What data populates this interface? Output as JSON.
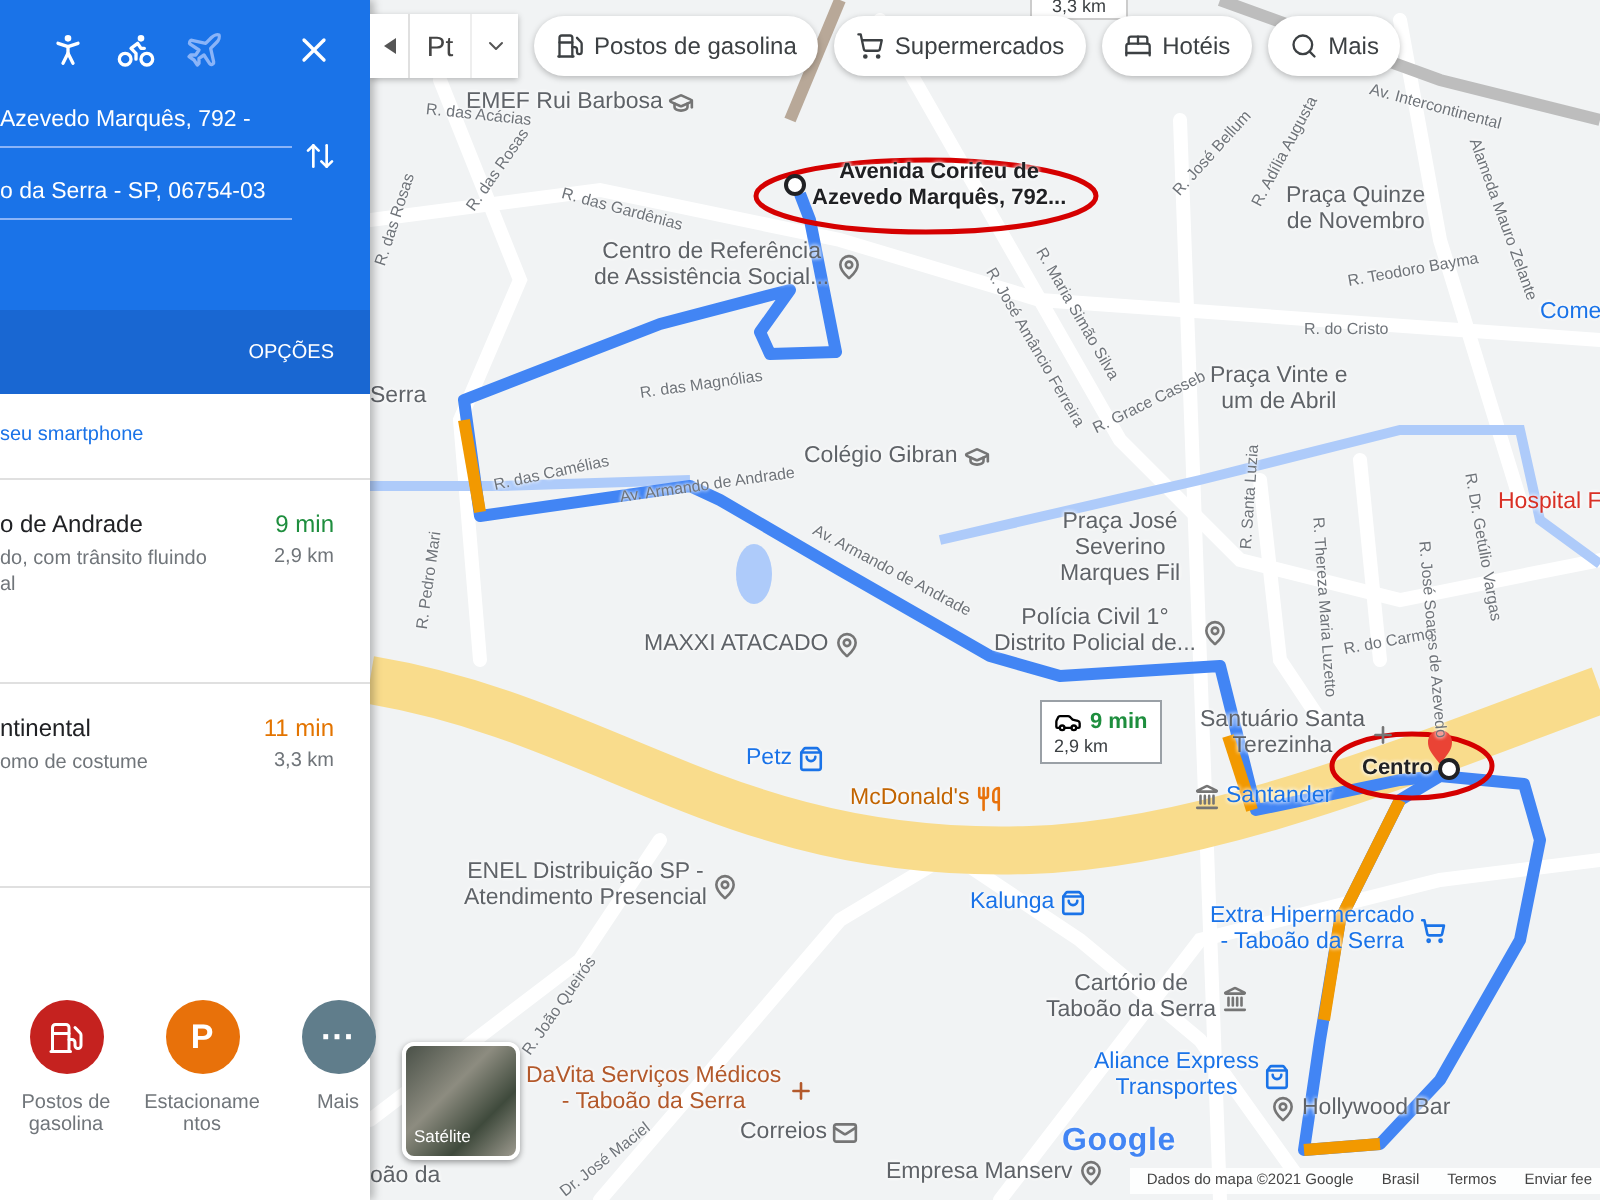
{
  "panel": {
    "modes": [
      {
        "kind": "walk",
        "disabled": false
      },
      {
        "kind": "bike",
        "disabled": false
      },
      {
        "kind": "plane",
        "disabled": true
      }
    ],
    "origin": "Azevedo Marquês, 792 -",
    "destination": "o da Serra - SP, 06754-03",
    "options_label": "OPÇÕES",
    "phone_link": "seu smartphone",
    "routes": [
      {
        "title": "o de Andrade",
        "time": "9 min",
        "color": "#1e8e3e",
        "lines": [
          "do, com trânsito fluindo",
          "al"
        ],
        "distance": "2,9 km"
      },
      {
        "title": "ntinental",
        "time": "11 min",
        "color": "#e37400",
        "lines": [
          "omo de costume"
        ],
        "distance": "3,3 km"
      }
    ],
    "categories": [
      {
        "kind": "gas",
        "label": "Postos de gasolina",
        "color": "#c5221f"
      },
      {
        "kind": "parking",
        "label": "Estacionamentos",
        "glyph": "P",
        "color": "#e8710a"
      },
      {
        "kind": "more",
        "label": "Mais",
        "glyph": "···",
        "color": "#607d8b"
      }
    ]
  },
  "map": {
    "layer_label": "Pt",
    "chips": [
      {
        "kind": "gas",
        "label": "Postos de gasolina"
      },
      {
        "kind": "cart",
        "label": "Supermercados"
      },
      {
        "kind": "bed",
        "label": "Hotéis"
      },
      {
        "kind": "search",
        "label": "Mais"
      }
    ],
    "top_distance": "3,3 km",
    "route_info": {
      "time": "9 min",
      "distance": "2,9 km"
    },
    "labels": [
      {
        "kind": "place",
        "lines": [
          "EMEF Rui Barbosa"
        ]
      },
      {
        "kind": "place",
        "lines": [
          "Centro de Referência",
          "de Assistência Social..."
        ]
      },
      {
        "kind": "marker",
        "lines": [
          "Avenida Corifeu de",
          "Azevedo Marquês, 792..."
        ]
      },
      {
        "kind": "place",
        "lines": [
          "Praça Quinze",
          "de Novembro"
        ]
      },
      {
        "kind": "street",
        "lines": [
          "R. Teodoro Bayma"
        ]
      },
      {
        "kind": "shop",
        "lines": [
          "Come"
        ]
      },
      {
        "kind": "street",
        "lines": [
          "R. do Cristo"
        ]
      },
      {
        "kind": "place",
        "lines": [
          "Praça Vinte e",
          "um de Abril"
        ]
      },
      {
        "kind": "place",
        "lines": [
          "Colégio Gibran"
        ]
      },
      {
        "kind": "place",
        "lines": [
          "Praça José",
          "Severino",
          "Marques Fil"
        ]
      },
      {
        "kind": "hospital",
        "lines": [
          "Hospital F"
        ]
      },
      {
        "kind": "place",
        "lines": [
          "MAXXI ATACADO"
        ]
      },
      {
        "kind": "place",
        "lines": [
          "Polícia Civil 1°",
          "Distrito Policial de..."
        ]
      },
      {
        "kind": "place",
        "lines": [
          "Santuário Santa",
          "Terezinha"
        ]
      },
      {
        "kind": "shop",
        "lines": [
          "Petz"
        ]
      },
      {
        "kind": "food",
        "lines": [
          "McDonald's"
        ]
      },
      {
        "kind": "shop",
        "lines": [
          "Santander"
        ]
      },
      {
        "kind": "marker",
        "lines": [
          "Centro"
        ]
      },
      {
        "kind": "place",
        "lines": [
          "ENEL Distribuição SP -",
          "Atendimento Presencial"
        ]
      },
      {
        "kind": "shop",
        "lines": [
          "Kalunga"
        ]
      },
      {
        "kind": "shop",
        "lines": [
          "Extra Hipermercado",
          "- Taboão da Serra"
        ]
      },
      {
        "kind": "place",
        "lines": [
          "Cartório de",
          "Taboão da Serra"
        ]
      },
      {
        "kind": "health",
        "lines": [
          "DaVita Serviços Médicos",
          "- Taboão da Serra"
        ]
      },
      {
        "kind": "shop",
        "lines": [
          "Aliance Express",
          "Transportes"
        ]
      },
      {
        "kind": "place",
        "lines": [
          "Hollywood Bar"
        ]
      },
      {
        "kind": "place",
        "lines": [
          "Correios"
        ]
      },
      {
        "kind": "place",
        "lines": [
          "Empresa Manserv"
        ]
      },
      {
        "kind": "street",
        "lines": [
          "R. das Acácias"
        ]
      },
      {
        "kind": "street",
        "lines": [
          "R. das Rosas"
        ]
      },
      {
        "kind": "street",
        "lines": [
          "R. das Gardênias"
        ]
      },
      {
        "kind": "street",
        "lines": [
          "R. das Rosas"
        ]
      },
      {
        "kind": "street",
        "lines": [
          "R. das Magnólias"
        ]
      },
      {
        "kind": "street",
        "lines": [
          "R. das Camélias"
        ]
      },
      {
        "kind": "street",
        "lines": [
          "Av. Armando de Andrade"
        ]
      },
      {
        "kind": "street",
        "lines": [
          "Av. Armando de Andrade"
        ]
      },
      {
        "kind": "street",
        "lines": [
          "R. Pedro Mari"
        ]
      },
      {
        "kind": "street",
        "lines": [
          "R. José Amâncio Ferreira"
        ]
      },
      {
        "kind": "street",
        "lines": [
          "R. Maria Simão Silva"
        ]
      },
      {
        "kind": "street",
        "lines": [
          "R. Grace Casseb"
        ]
      },
      {
        "kind": "street",
        "lines": [
          "R. José Bellum"
        ]
      },
      {
        "kind": "street",
        "lines": [
          "R. Adília Augusta"
        ]
      },
      {
        "kind": "street",
        "lines": [
          "Av. Intercontinental"
        ]
      },
      {
        "kind": "street",
        "lines": [
          "Alameda Mauro Zelante"
        ]
      },
      {
        "kind": "street",
        "lines": [
          "R. Santa Luzia"
        ]
      },
      {
        "kind": "street",
        "lines": [
          "R. Thereza Maria Luzetto"
        ]
      },
      {
        "kind": "street",
        "lines": [
          "R. José Soares de Azevedo"
        ]
      },
      {
        "kind": "street",
        "lines": [
          "R. Dr. Getúlio Vargas"
        ]
      },
      {
        "kind": "street",
        "lines": [
          "R. do Carmo"
        ]
      },
      {
        "kind": "street",
        "lines": [
          "R. João Queirós"
        ]
      },
      {
        "kind": "street",
        "lines": [
          "Dr. José Maciel"
        ]
      },
      {
        "kind": "place",
        "lines": [
          "Serra"
        ]
      },
      {
        "kind": "place",
        "lines": [
          "oão da"
        ]
      }
    ],
    "satellite_label": "Satélite",
    "logo": "Google",
    "footer": [
      "Dados do mapa ©2021 Google",
      "Brasil",
      "Termos",
      "Enviar fee"
    ]
  }
}
